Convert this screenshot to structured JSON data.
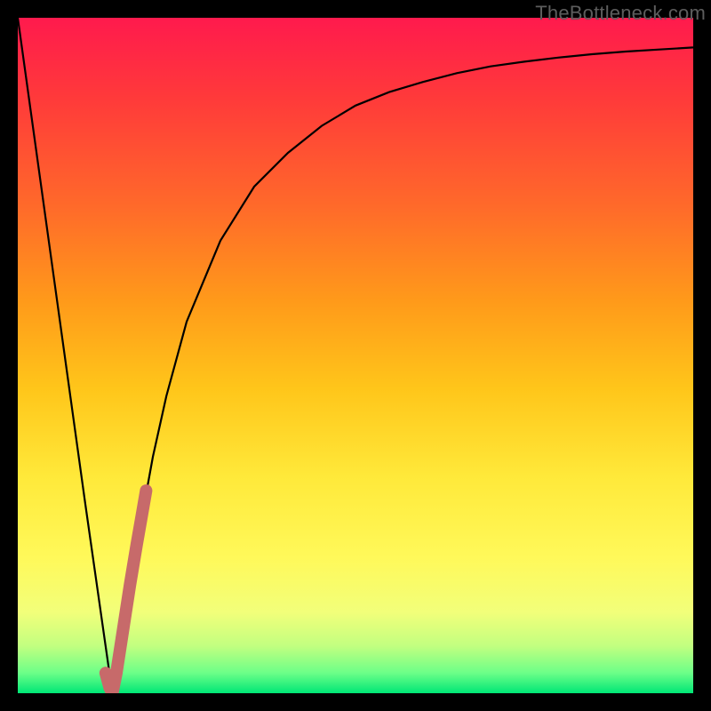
{
  "watermark": "TheBottleneck.com",
  "chart_data": {
    "type": "line",
    "title": "",
    "xlabel": "",
    "ylabel": "",
    "xlim": [
      0,
      100
    ],
    "ylim": [
      0,
      100
    ],
    "series": [
      {
        "name": "bottleneck-curve",
        "x": [
          0,
          5,
          10,
          13,
          14,
          15,
          16,
          18,
          20,
          22,
          25,
          30,
          35,
          40,
          45,
          50,
          55,
          60,
          65,
          70,
          75,
          80,
          85,
          90,
          95,
          100
        ],
        "y": [
          100,
          64,
          28,
          7,
          0,
          6,
          12,
          24,
          35,
          44,
          55,
          67,
          75,
          80,
          84,
          87,
          89,
          90.5,
          91.8,
          92.8,
          93.5,
          94.1,
          94.6,
          95.0,
          95.3,
          95.6
        ]
      },
      {
        "name": "highlight-segment",
        "x": [
          13.0,
          13.6,
          14.0,
          14.6,
          15.6,
          16.6,
          17.6,
          18.4,
          19.0
        ],
        "y": [
          3.0,
          0.8,
          0.0,
          3.0,
          9.5,
          16.0,
          22.0,
          26.5,
          30.0
        ]
      }
    ],
    "gradient_stops": [
      {
        "pos": 0,
        "color": "#ff1a4d"
      },
      {
        "pos": 12,
        "color": "#ff3a3a"
      },
      {
        "pos": 28,
        "color": "#ff6a2a"
      },
      {
        "pos": 42,
        "color": "#ff9a1a"
      },
      {
        "pos": 55,
        "color": "#ffc61a"
      },
      {
        "pos": 68,
        "color": "#ffe93a"
      },
      {
        "pos": 80,
        "color": "#fff95a"
      },
      {
        "pos": 88,
        "color": "#f2ff7a"
      },
      {
        "pos": 93,
        "color": "#c2ff80"
      },
      {
        "pos": 97,
        "color": "#6cff88"
      },
      {
        "pos": 100,
        "color": "#00e676"
      }
    ],
    "colors": {
      "curve": "#000000",
      "highlight": "#c76a6a",
      "frame": "#000000"
    }
  }
}
